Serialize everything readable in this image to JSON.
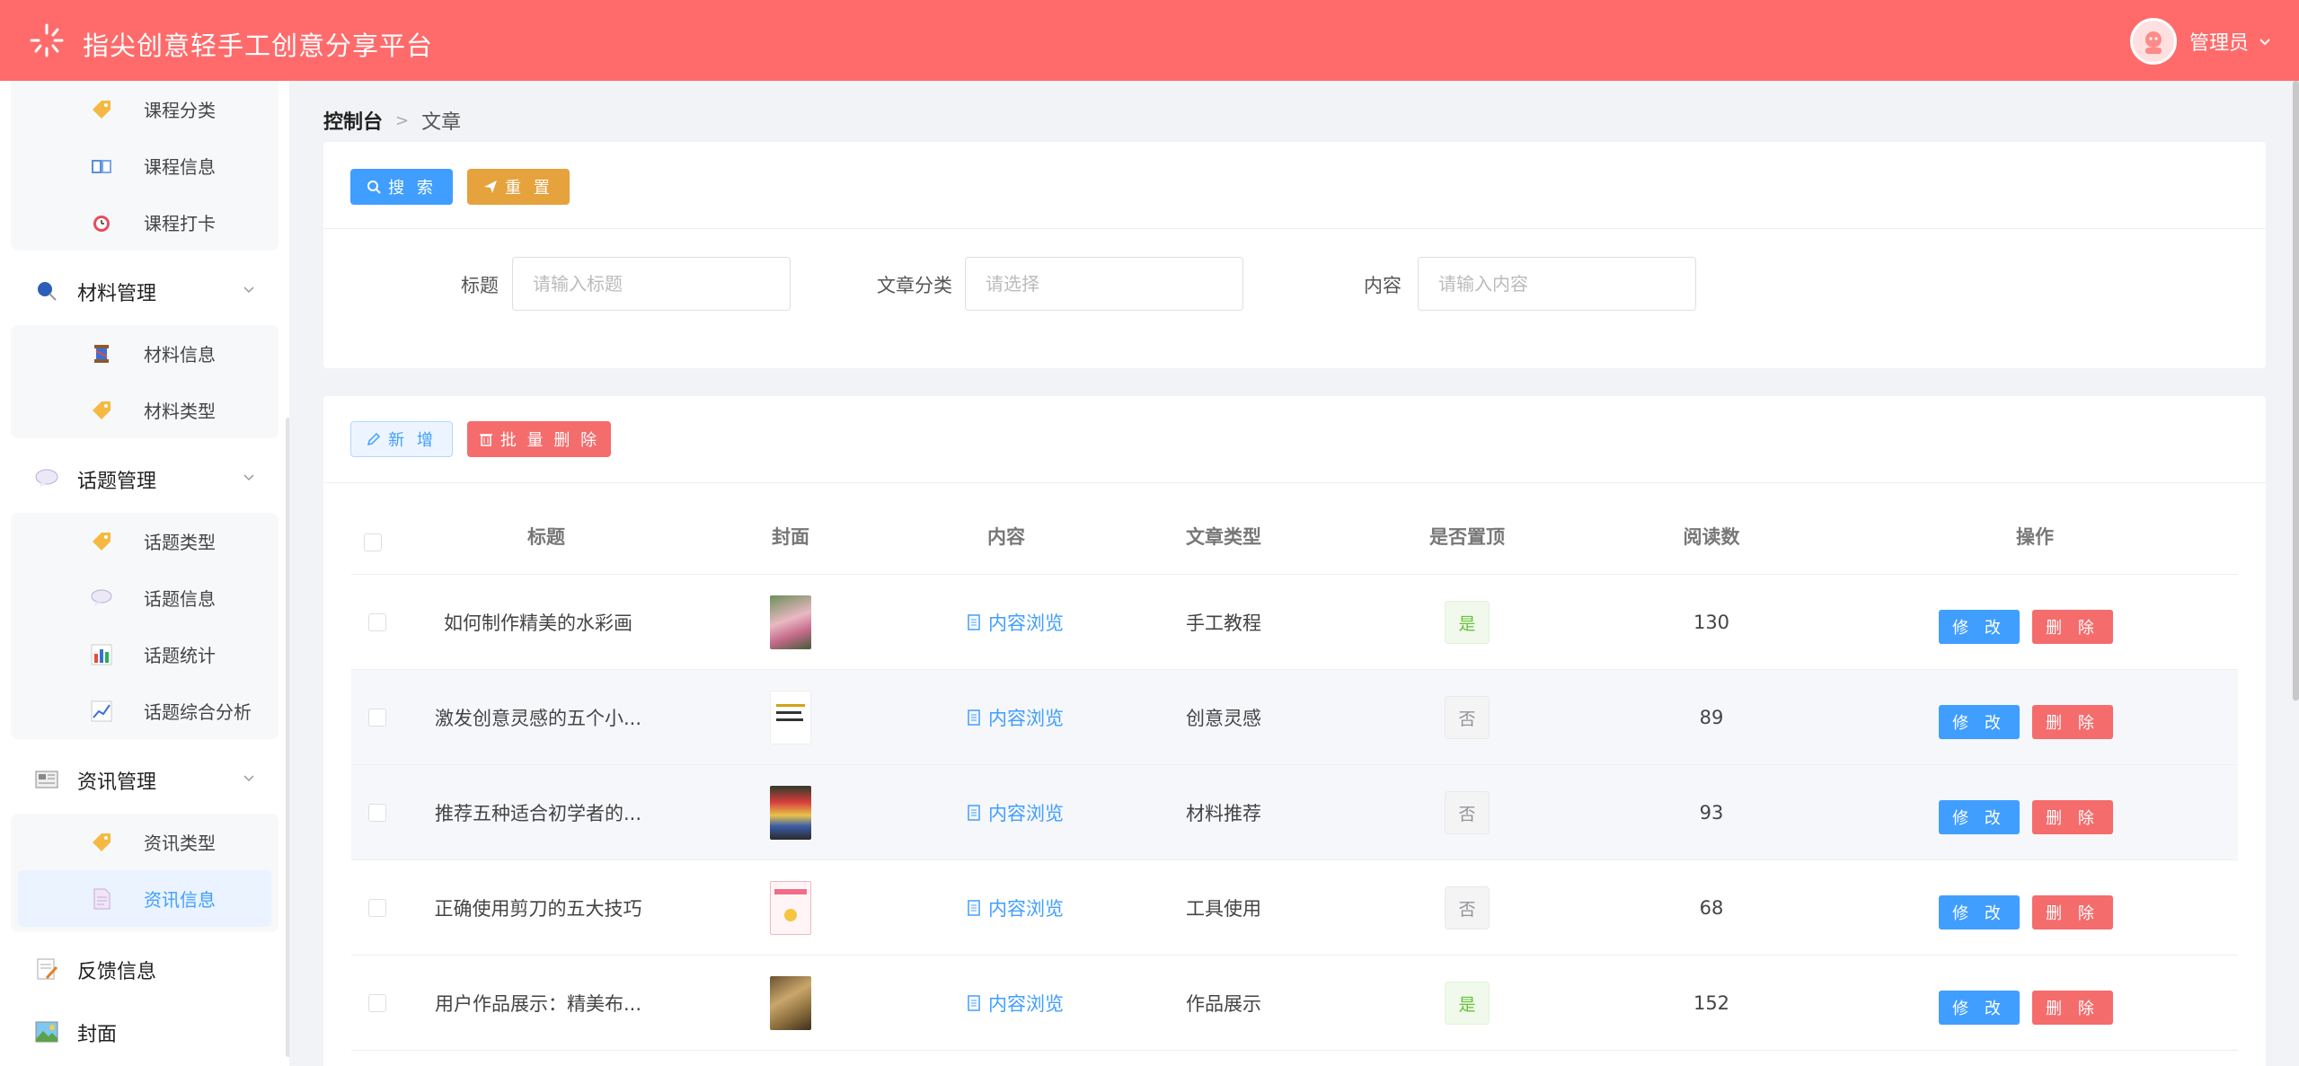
{
  "header": {
    "title": "指尖创意轻手工创意分享平台",
    "user_name": "管理员"
  },
  "sidebar": {
    "group1": [
      {
        "label": "课程分类",
        "icon": "tag-icon"
      },
      {
        "label": "课程信息",
        "icon": "book-icon"
      },
      {
        "label": "课程打卡",
        "icon": "alarm-clock-icon"
      }
    ],
    "materials": {
      "label": "材料管理",
      "icon": "pushpin-icon"
    },
    "group2": [
      {
        "label": "材料信息",
        "icon": "spool-icon"
      },
      {
        "label": "材料类型",
        "icon": "tag-icon"
      }
    ],
    "topics": {
      "label": "话题管理",
      "icon": "speech-bubble-icon"
    },
    "group3": [
      {
        "label": "话题类型",
        "icon": "tag-icon"
      },
      {
        "label": "话题信息",
        "icon": "speech-bubble-icon"
      },
      {
        "label": "话题统计",
        "icon": "bar-chart-icon"
      },
      {
        "label": "话题综合分析",
        "icon": "line-chart-icon"
      }
    ],
    "news": {
      "label": "资讯管理",
      "icon": "newspaper-icon"
    },
    "group4": [
      {
        "label": "资讯类型",
        "icon": "tag-icon"
      },
      {
        "label": "资讯信息",
        "icon": "document-icon"
      }
    ],
    "feedback": {
      "label": "反馈信息",
      "icon": "memo-icon"
    },
    "cover": {
      "label": "封面",
      "icon": "picture-icon"
    }
  },
  "breadcrumb": {
    "home": "控制台",
    "current": "文章"
  },
  "search_card": {
    "search_label": "搜 索",
    "reset_label": "重 置",
    "fields": [
      {
        "label": "标题",
        "placeholder": "请输入标题"
      },
      {
        "label": "文章分类",
        "placeholder": "请选择"
      },
      {
        "label": "内容",
        "placeholder": "请输入内容"
      }
    ]
  },
  "table_card": {
    "add_label": "新 增",
    "batch_delete_label": "批 量 删 除",
    "columns": [
      "标题",
      "封面",
      "内容",
      "文章类型",
      "是否置顶",
      "阅读数",
      "操作"
    ],
    "view_label": "内容浏览",
    "edit_label": "修 改",
    "delete_label": "删 除",
    "rows": [
      {
        "title": "如何制作精美的水彩画",
        "type": "手工教程",
        "pinned": "是",
        "reads": "130"
      },
      {
        "title": "激发创意灵感的五个小...",
        "type": "创意灵感",
        "pinned": "否",
        "reads": "89"
      },
      {
        "title": "推荐五种适合初学者的...",
        "type": "材料推荐",
        "pinned": "否",
        "reads": "93"
      },
      {
        "title": "正确使用剪刀的五大技巧",
        "type": "工具使用",
        "pinned": "否",
        "reads": "68"
      },
      {
        "title": "用户作品展示：精美布...",
        "type": "作品展示",
        "pinned": "是",
        "reads": "152"
      }
    ]
  },
  "colors": {
    "header": "#ff6b6b",
    "primary": "#409eff",
    "warning": "#e6a23c",
    "danger": "#f56c6c"
  }
}
